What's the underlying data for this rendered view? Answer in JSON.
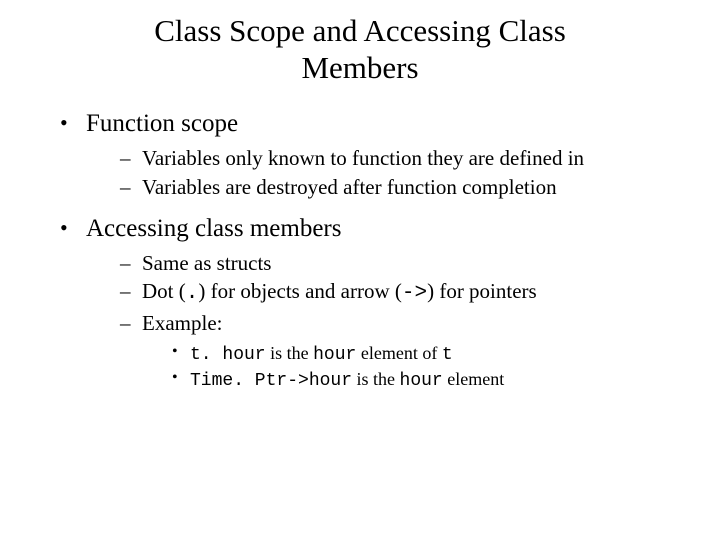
{
  "title": "Class Scope and Accessing Class Members",
  "bullets": [
    {
      "text": "Function scope",
      "children": [
        {
          "text": "Variables only known to function they are defined in"
        },
        {
          "text": "Variables are destroyed after function completion"
        }
      ]
    },
    {
      "text": "Accessing class members",
      "children": [
        {
          "text": "Same as structs"
        },
        {
          "prefix": "Dot (",
          "code1": ".",
          "mid": ") for objects and arrow (",
          "code2": "->",
          "suffix": ") for pointers"
        },
        {
          "text": "Example:",
          "children": [
            {
              "code1": "t. hour",
              "mid1": " is the ",
              "code2": "hour",
              "mid2": " element of ",
              "code3": "t"
            },
            {
              "code1": "Time. Ptr->hour",
              "mid1": " is the ",
              "code2": "hour",
              "mid2": " element"
            }
          ]
        }
      ]
    }
  ]
}
